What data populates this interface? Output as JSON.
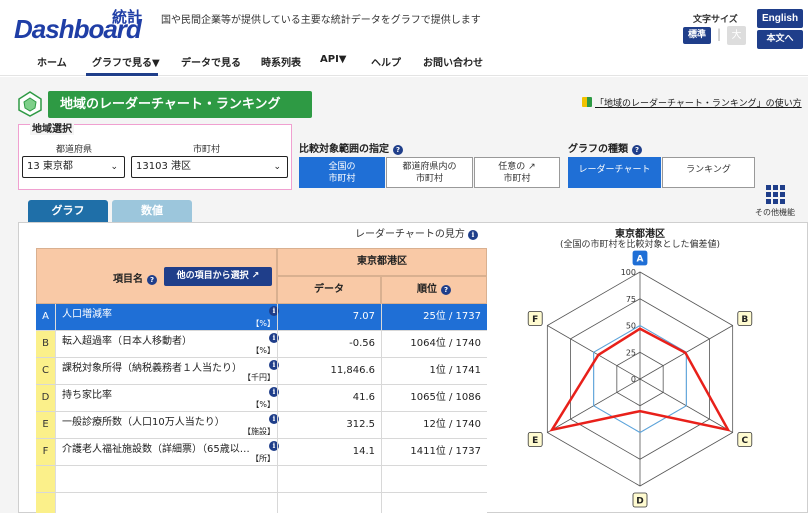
{
  "header": {
    "logo_text": "Dashboard",
    "logo_kanji": "統計",
    "tagline": "国や民間企業等が提供している主要な統計データをグラフで提供します",
    "font_size_label": "文字サイズ",
    "font_size_standard": "標準",
    "font_size_separator": "|",
    "font_size_large": "大",
    "english_button": "English",
    "plain_button": "本文へ"
  },
  "nav": {
    "items": [
      "ホーム",
      "グラフで見る▼",
      "データで見る",
      "時系列表",
      "API▼",
      "ヘルプ",
      "お問い合わせ"
    ],
    "active_index": 1
  },
  "page": {
    "title": "地域のレーダーチャート・ランキング",
    "howto_link": "「地域のレーダーチャート・ランキング」の使い方"
  },
  "region": {
    "legend": "地域選択",
    "pref_label": "都道府県",
    "pref_value": "13 東京都",
    "city_label": "市町村",
    "city_value": "13103 港区"
  },
  "compare": {
    "label": "比較対象範囲の指定",
    "options": [
      {
        "line1": "全国の",
        "line2": "市町村",
        "active": true
      },
      {
        "line1": "都道府県内の",
        "line2": "市町村",
        "active": false
      },
      {
        "line1": "任意の",
        "line2": "市町村",
        "active": false
      }
    ]
  },
  "graph_type": {
    "label": "グラフの種類",
    "options": [
      {
        "label": "レーダーチャート",
        "active": true
      },
      {
        "label": "ランキング",
        "active": false
      }
    ]
  },
  "other_functions_label": "その他機能",
  "tabs": {
    "graph": "グラフ",
    "value": "数値"
  },
  "radar_howto": "レーダーチャートの見方",
  "table": {
    "item_header": "項目名",
    "item_button": "他の項目から選択",
    "region_header": "東京都港区",
    "data_header": "データ",
    "rank_header": "順位",
    "rows": [
      {
        "letter": "A",
        "name": "人口増減率",
        "unit": "【%】",
        "value": "7.07",
        "rank": "25位 /  1737",
        "selected": true
      },
      {
        "letter": "B",
        "name": "転入超過率（日本人移動者）",
        "unit": "【%】",
        "value": "-0.56",
        "rank": "1064位 /  1740",
        "selected": false
      },
      {
        "letter": "C",
        "name": "課税対象所得（納税義務者１人当たり）",
        "unit": "【千円】",
        "value": "11,846.6",
        "rank": "1位 /  1741",
        "selected": false
      },
      {
        "letter": "D",
        "name": "持ち家比率",
        "unit": "【%】",
        "value": "41.6",
        "rank": "1065位 /  1086",
        "selected": false
      },
      {
        "letter": "E",
        "name": "一般診療所数（人口10万人当たり）",
        "unit": "【施設】",
        "value": "312.5",
        "rank": "12位 /  1740",
        "selected": false
      },
      {
        "letter": "F",
        "name": "介護老人福祉施設数（詳細票）（65歳以…",
        "unit": "【所】",
        "value": "14.1",
        "rank": "1411位 /  1737",
        "selected": false
      }
    ]
  },
  "radar": {
    "title": "東京都港区",
    "subtitle": "(全国の市町村を比較対象とした偏差値)",
    "axes": [
      "A",
      "B",
      "C",
      "D",
      "E",
      "F"
    ],
    "scale_labels": [
      "100",
      "75",
      "50",
      "25",
      "0"
    ],
    "max": 100,
    "reference_value": 50,
    "values": [
      47,
      49,
      95,
      30,
      95,
      45
    ],
    "colors": {
      "series": "#e8201a",
      "reference": "#5aa9e6",
      "grid": "#555555",
      "axis_A_bg": "#1f6fd6",
      "axis_other_bg": "#fffbd0"
    }
  }
}
